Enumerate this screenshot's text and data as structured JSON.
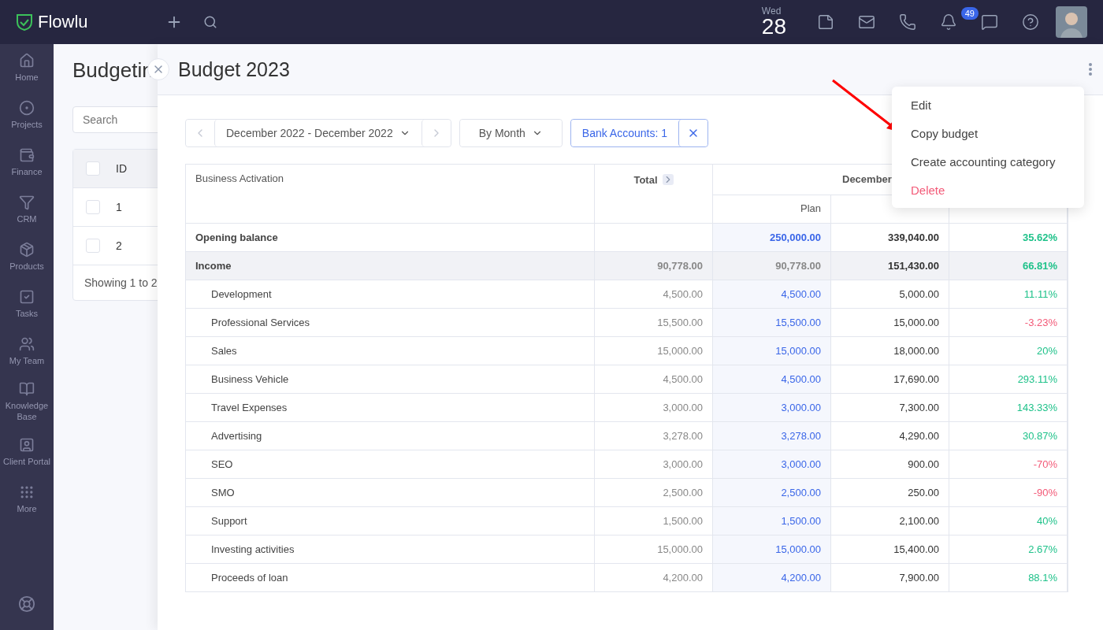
{
  "topbar": {
    "logo": "Flowlu",
    "date": {
      "weekday": "Wed",
      "day": "28"
    },
    "notifications_badge": "49"
  },
  "sidebar": {
    "items": [
      {
        "label": "Home"
      },
      {
        "label": "Projects"
      },
      {
        "label": "Finance"
      },
      {
        "label": "CRM"
      },
      {
        "label": "Products"
      },
      {
        "label": "Tasks"
      },
      {
        "label": "My Team"
      },
      {
        "label": "Knowledge Base"
      },
      {
        "label": "Client Portal"
      },
      {
        "label": "More"
      }
    ]
  },
  "background_page": {
    "title": "Budgetin",
    "search": {
      "placeholder": "Search"
    },
    "table": {
      "header_checked": false,
      "column": "ID",
      "rows": [
        {
          "id": "1",
          "checked": false
        },
        {
          "id": "2",
          "checked": false
        }
      ],
      "footer": "Showing 1 to 2"
    }
  },
  "panel": {
    "title": "Budget 2023",
    "toolbar": {
      "period": "December 2022 - December 2022",
      "grouping": "By Month",
      "filter": "Bank Accounts: 1"
    },
    "table": {
      "name_header": "Business Activation",
      "total_header": "Total",
      "month_header": "December",
      "subcolumns": [
        "Plan"
      ],
      "rows": [
        {
          "kind": "summary",
          "name": "Opening balance",
          "plan": "250,000.00",
          "actual": "339,040.00",
          "diff": "35.62%",
          "color": "#1fc28a"
        },
        {
          "kind": "group",
          "name": "Income",
          "total": "90,778.00",
          "plan": "90,778.00",
          "actual": "151,430.00",
          "diff": "66.81%",
          "color": "#1fc28a"
        },
        {
          "kind": "item",
          "name": "Development",
          "total": "4,500.00",
          "plan": "4,500.00",
          "actual": "5,000.00",
          "diff": "11.11%",
          "color": "#1fc28a"
        },
        {
          "kind": "item",
          "name": "Professional Services",
          "total": "15,500.00",
          "plan": "15,500.00",
          "actual": "15,000.00",
          "diff": "-3.23%",
          "color": "#f35a78"
        },
        {
          "kind": "item",
          "name": "Sales",
          "total": "15,000.00",
          "plan": "15,000.00",
          "actual": "18,000.00",
          "diff": "20%",
          "color": "#1fc28a"
        },
        {
          "kind": "item",
          "name": "Business Vehicle",
          "total": "4,500.00",
          "plan": "4,500.00",
          "actual": "17,690.00",
          "diff": "293.11%",
          "color": "#1fc28a"
        },
        {
          "kind": "item",
          "name": "Travel Expenses",
          "total": "3,000.00",
          "plan": "3,000.00",
          "actual": "7,300.00",
          "diff": "143.33%",
          "color": "#1fc28a"
        },
        {
          "kind": "item",
          "name": "Advertising",
          "total": "3,278.00",
          "plan": "3,278.00",
          "actual": "4,290.00",
          "diff": "30.87%",
          "color": "#1fc28a"
        },
        {
          "kind": "item",
          "name": "SEO",
          "total": "3,000.00",
          "plan": "3,000.00",
          "actual": "900.00",
          "diff": "-70%",
          "color": "#f35a78"
        },
        {
          "kind": "item",
          "name": "SMO",
          "total": "2,500.00",
          "plan": "2,500.00",
          "actual": "250.00",
          "diff": "-90%",
          "color": "#f35a78"
        },
        {
          "kind": "item",
          "name": "Support",
          "total": "1,500.00",
          "plan": "1,500.00",
          "actual": "2,100.00",
          "diff": "40%",
          "color": "#1fc28a"
        },
        {
          "kind": "item",
          "name": "Investing activities",
          "total": "15,000.00",
          "plan": "15,000.00",
          "actual": "15,400.00",
          "diff": "2.67%",
          "color": "#1fc28a"
        },
        {
          "kind": "item",
          "name": "Proceeds of loan",
          "total": "4,200.00",
          "plan": "4,200.00",
          "actual": "7,900.00",
          "diff": "88.1%",
          "color": "#1fc28a"
        }
      ]
    },
    "menu": [
      {
        "label": "Edit",
        "kind": "normal"
      },
      {
        "label": "Copy budget",
        "kind": "normal"
      },
      {
        "label": "Create accounting category",
        "kind": "normal"
      },
      {
        "label": "Delete",
        "kind": "danger"
      }
    ]
  }
}
